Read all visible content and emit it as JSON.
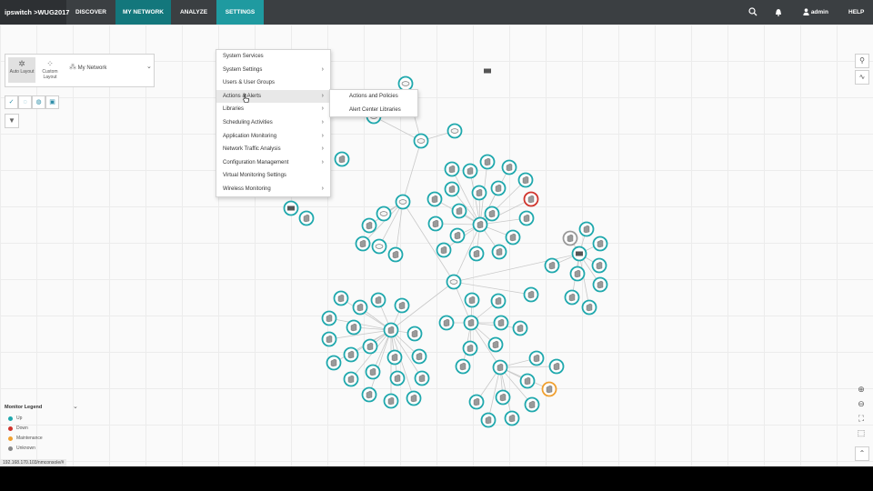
{
  "topbar": {
    "logo": "ipswitch >WUG2017",
    "nav": [
      {
        "label": "DISCOVER"
      },
      {
        "label": "MY NETWORK"
      },
      {
        "label": "ANALYZE"
      },
      {
        "label": "SETTINGS"
      }
    ],
    "user": "admin",
    "help": "HELP",
    "colors": {
      "bar": "#3b3f42",
      "logo_bg": "#2d3033",
      "active": "#1f9aa0",
      "my_network": "#13777c"
    }
  },
  "layout_panel": {
    "auto_layout": "Auto Layout",
    "custom_layout": "Custom Layout",
    "network_select": "My Network"
  },
  "settings_menu": {
    "items": [
      {
        "label": "System Services",
        "submenu": false
      },
      {
        "label": "System Settings",
        "submenu": true
      },
      {
        "label": "Users & User Groups",
        "submenu": false
      },
      {
        "label": "Actions & Alerts",
        "submenu": true
      },
      {
        "label": "Libraries",
        "submenu": true
      },
      {
        "label": "Scheduling Activities",
        "submenu": true
      },
      {
        "label": "Application Monitoring",
        "submenu": true
      },
      {
        "label": "Network Traffic Analysis",
        "submenu": true
      },
      {
        "label": "Configuration Management",
        "submenu": true
      },
      {
        "label": "Virtual Monitoring Settings",
        "submenu": false
      },
      {
        "label": "Wireless Monitoring",
        "submenu": true
      }
    ],
    "hovered_index": 3
  },
  "actions_submenu": {
    "items": [
      {
        "label": "Actions and Policies"
      },
      {
        "label": "Alert Center Libraries"
      }
    ]
  },
  "legend": {
    "title": "Monitor Legend",
    "items": [
      {
        "label": "Up",
        "color": "#1fa8ad"
      },
      {
        "label": "Down",
        "color": "#d0342c"
      },
      {
        "label": "Maintenance",
        "color": "#f0a030"
      },
      {
        "label": "Unknown",
        "color": "#888888"
      }
    ]
  },
  "status_bar": {
    "url": "192.168.170.103/nmconsole/#"
  },
  "map": {
    "colors": {
      "up": "#1fa8ad",
      "down": "#d0342c",
      "maintenance": "#f0a030",
      "unknown": "#999999"
    }
  }
}
